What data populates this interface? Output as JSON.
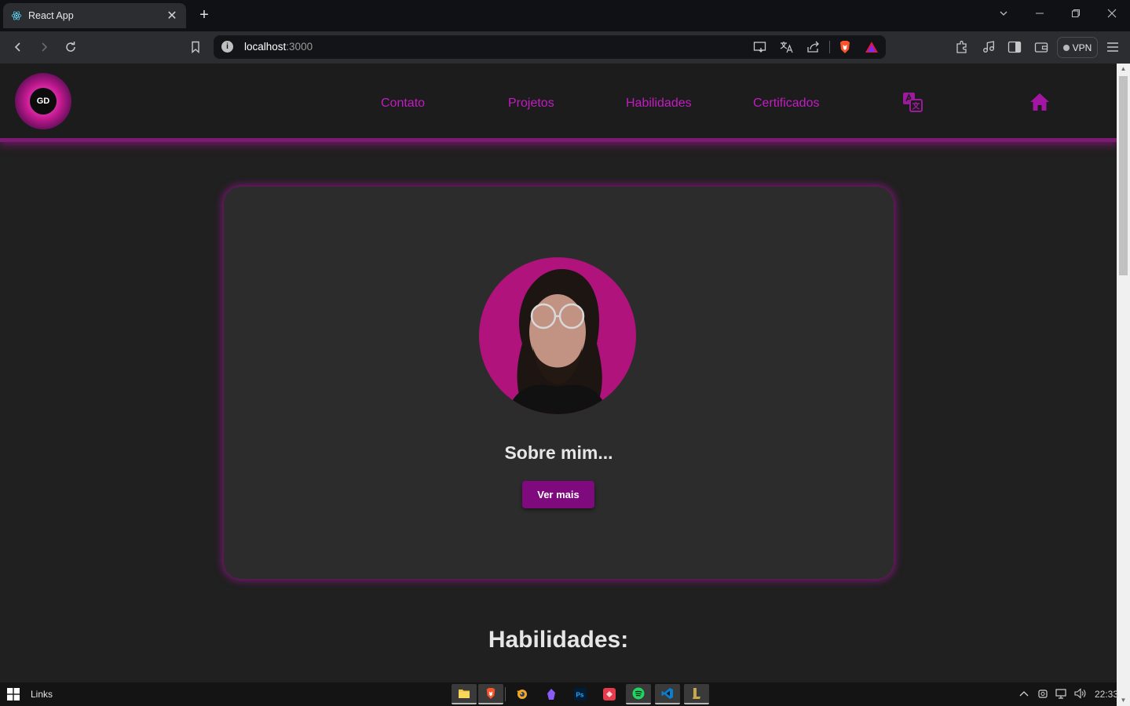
{
  "browser": {
    "tab_title": "React App",
    "tab_close": "✕",
    "new_tab": "+",
    "url_host": "localhost",
    "url_port": ":3000",
    "vpn_label": "VPN",
    "icons": [
      "back-icon",
      "forward-icon",
      "reload-icon",
      "bookmark-icon",
      "cast-icon",
      "translate-icon",
      "share-icon",
      "brave-shield-icon",
      "brave-rewards-icon",
      "extensions-icon",
      "media-icon",
      "sidebar-icon",
      "wallet-icon",
      "menu-icon"
    ]
  },
  "site": {
    "logo_text": "GD",
    "nav": [
      {
        "label": "Contato"
      },
      {
        "label": "Projetos"
      },
      {
        "label": "Habilidades"
      },
      {
        "label": "Certificados"
      }
    ],
    "accent": "#c21cc2",
    "card": {
      "title": "Sobre mim...",
      "button": "Ver mais",
      "avatar_bg": "#b0137c"
    },
    "section_title": "Habilidades:"
  },
  "taskbar": {
    "label": "Links",
    "clock": "22:33",
    "apps": [
      "file-explorer-icon",
      "brave-icon",
      "blender-icon",
      "obsidian-icon",
      "photoshop-icon",
      "app-icon",
      "spotify-icon",
      "vscode-icon",
      "league-icon"
    ]
  }
}
